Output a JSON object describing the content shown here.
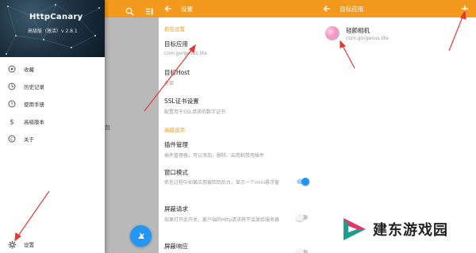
{
  "drawer": {
    "app_title": "HttpCanary",
    "app_subtitle": "高级版（激活）v 2.8.1",
    "menu": [
      {
        "label": "收藏",
        "icon": "collections-icon"
      },
      {
        "label": "历史记录",
        "icon": "history-icon"
      },
      {
        "label": "使用手册",
        "icon": "help-icon"
      },
      {
        "label": "高级版本",
        "icon": "dollar-icon"
      },
      {
        "label": "关于",
        "icon": "copyright-icon"
      }
    ],
    "settings_label": "设置",
    "background_fragment": "包",
    "header_icons": [
      "search-icon",
      "filter-icon"
    ],
    "fab_icon": "capture-icon"
  },
  "settings": {
    "title": "设置",
    "section_capture": "抓包设置",
    "target_app": {
      "title": "目标应用",
      "value": "com.gorgeous.lite"
    },
    "target_host": {
      "title": "目标Host",
      "value": "全部"
    },
    "ssl": {
      "title": "SSL证书设置",
      "value": "配置用于SSL请求的数字证书"
    },
    "section_advanced": "高级选项",
    "plugin": {
      "title": "插件管理",
      "value": "插件管理器，可以添加、删除、启用和禁用插件"
    },
    "window_mode": {
      "title": "窗口模式",
      "value": "抓包过程中如果应用被回到后台，显示一个mini悬浮窗",
      "enabled": true
    },
    "block_request": {
      "title": "屏蔽请求",
      "value": "如果打开此开关，客户端的Http请求将不会发给服务器",
      "enabled": false
    },
    "block_response": {
      "title": "屏蔽响应",
      "enabled": false
    }
  },
  "target_apps": {
    "title": "目标应用",
    "add_icon": "plus-icon",
    "apps": [
      {
        "name": "轻颜相机",
        "package": "com.gorgeous.lite"
      }
    ]
  },
  "watermark": {
    "text": "建东游戏园"
  },
  "colors": {
    "primary": "#f39a1e",
    "accent": "#2196f3",
    "annotation": "#e53935"
  }
}
